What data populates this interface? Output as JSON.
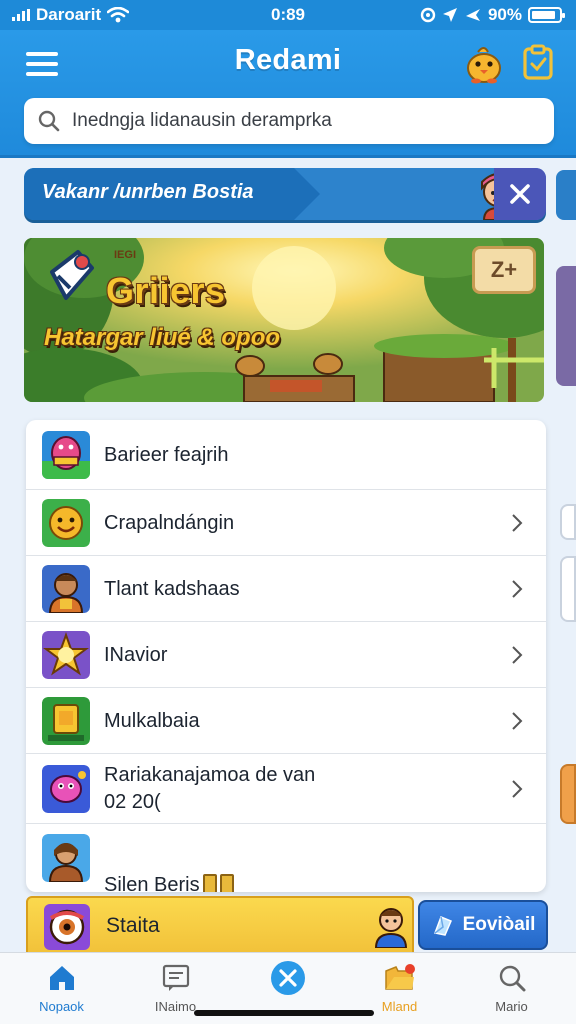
{
  "status_bar": {
    "carrier": "Daroarit",
    "time": "0:89",
    "battery": "90%",
    "battery_level": 0.9
  },
  "header": {
    "title": "Redami",
    "search_placeholder": "Inedngja lidanausin deramprka"
  },
  "promo": {
    "text": "Vakanr /unrben Bostia"
  },
  "hero": {
    "title": "Griiers",
    "subtitle": "Hatargar liué & opoo",
    "badge": "Z+"
  },
  "list": {
    "items": [
      {
        "label": "Barieer feajrih",
        "icon": "candy-game-icon",
        "chevron": false
      },
      {
        "label": "Crapalndángin",
        "icon": "smiley-face-game-icon",
        "chevron": true
      },
      {
        "label": "Tlant kadshaas",
        "icon": "warrior-portrait-icon",
        "chevron": true
      },
      {
        "label": "INavior",
        "icon": "star-badge-icon",
        "chevron": true
      },
      {
        "label": "Mulkalbaia",
        "icon": "gold-card-icon",
        "chevron": true
      },
      {
        "label": "Rariakanajamoa de van\n02 20(",
        "icon": "pink-creature-icon",
        "chevron": true
      },
      {
        "label": "Silen Beris",
        "icon": "adventurer-portrait-icon",
        "chevron": false
      }
    ]
  },
  "bottom_strip": {
    "label": "Staita",
    "action_label": "Eoviòail"
  },
  "tabs": [
    {
      "label": "Nopaok",
      "icon": "home-icon"
    },
    {
      "label": "INaimo",
      "icon": "message-icon"
    },
    {
      "label": "",
      "icon": "close-circle-icon"
    },
    {
      "label": "Mland",
      "icon": "folder-badge-icon"
    },
    {
      "label": "Mario",
      "icon": "search-icon"
    }
  ],
  "colors": {
    "primary_blue": "#1f8adb",
    "gold": "#f7c531",
    "active_tab": "#1f7bd0"
  }
}
